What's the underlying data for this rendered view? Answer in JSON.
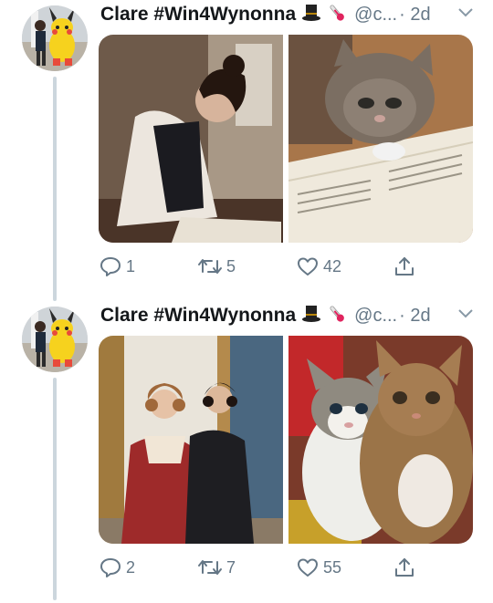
{
  "tweets": [
    {
      "display_name": "Clare #Win4Wynonna",
      "handle": "@c...",
      "time": "· 2d",
      "emojis": [
        "top-hat-icon",
        "thermometer-icon"
      ],
      "media": [
        "painting-woman-writing-photo",
        "cat-reading-book-photo"
      ],
      "actions": {
        "reply_count": "1",
        "retweet_count": "5",
        "like_count": "42"
      }
    },
    {
      "display_name": "Clare #Win4Wynonna",
      "handle": "@c...",
      "time": "· 2d",
      "emojis": [
        "top-hat-icon",
        "thermometer-icon"
      ],
      "media": [
        "period-drama-couple-photo",
        "two-cats-hugging-photo"
      ],
      "actions": {
        "reply_count": "2",
        "retweet_count": "7",
        "like_count": "55"
      }
    }
  ],
  "colors": {
    "action_gray": "#657786",
    "thread_line": "#ccd6dd",
    "text": "#14171a"
  }
}
